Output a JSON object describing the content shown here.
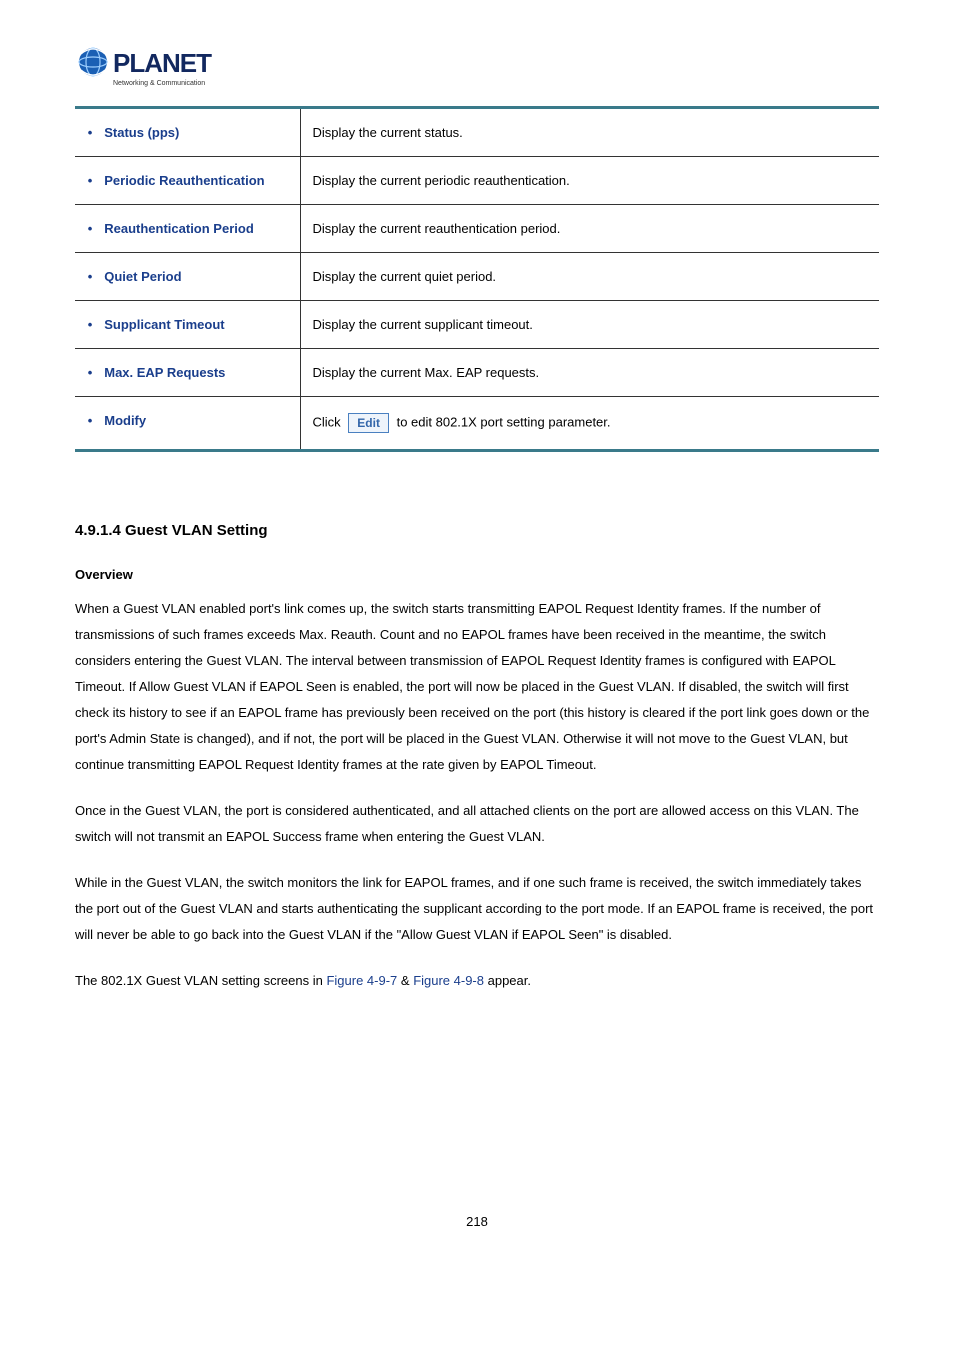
{
  "table_rows": [
    {
      "label": "Status (pps)",
      "desc": "Display the current status."
    },
    {
      "label": "Periodic Reauthentication",
      "desc": "Display the current periodic reauthentication."
    },
    {
      "label": "Reauthentication Period",
      "desc": "Display the current reauthentication period."
    },
    {
      "label": "Quiet Period",
      "desc": "Display the current quiet period."
    },
    {
      "label": "Supplicant Timeout",
      "desc": "Display the current supplicant timeout."
    },
    {
      "label": "Max. EAP Requests",
      "desc": "Display the current Max. EAP requests."
    }
  ],
  "modify": {
    "label": "Modify",
    "click_text": "Click",
    "button_text": "Edit",
    "after_text": " to edit 802.1X port setting parameter."
  },
  "section_title": "4.9.1.4 Guest VLAN Setting",
  "overview_label": "Overview",
  "para1": "When a Guest VLAN enabled port's link comes up, the switch starts transmitting EAPOL Request Identity frames. If the number of transmissions of such frames exceeds Max. Reauth. Count and no EAPOL frames have been received in the meantime, the switch considers entering the Guest VLAN. The interval between transmission of EAPOL Request Identity frames is configured with EAPOL Timeout. If Allow Guest VLAN if EAPOL Seen is enabled, the port will now be placed in the Guest VLAN. If disabled, the switch will first check its history to see if an EAPOL frame has previously been received on the port (this history is cleared if the port link goes down or the port's Admin State is changed), and if not, the port will be placed in the Guest VLAN. Otherwise it will not move to the Guest VLAN, but continue transmitting EAPOL Request Identity frames at the rate given by EAPOL Timeout.",
  "para2": "Once in the Guest VLAN, the port is considered authenticated, and all attached clients on the port are allowed access on this VLAN. The switch will not transmit an EAPOL Success frame when entering the Guest VLAN.",
  "para3": "While in the Guest VLAN, the switch monitors the link for EAPOL frames, and if one such frame is received, the switch immediately takes the port out of the Guest VLAN and starts authenticating the supplicant according to the port mode. If an EAPOL frame is received, the port will never be able to go back into the Guest VLAN if the \"Allow Guest VLAN if EAPOL Seen\" is disabled.",
  "para4_pre": "The 802.1X Guest VLAN setting screens in ",
  "para4_link1": "Figure 4-9-7",
  "para4_mid": " & ",
  "para4_link2": "Figure 4-9-8",
  "para4_post": " appear.",
  "page_number": "218",
  "logo_tagline": "Networking & Communication"
}
